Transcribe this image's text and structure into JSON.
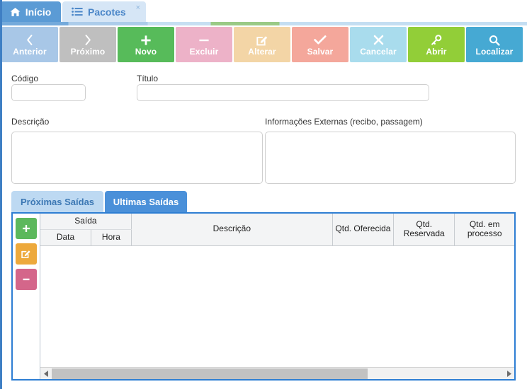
{
  "window": {
    "tabs": [
      {
        "label": "Início",
        "icon": "home-icon",
        "active": true,
        "closable": false
      },
      {
        "label": "Pacotes",
        "icon": "list-icon",
        "active": false,
        "closable": true,
        "close_label": "×"
      }
    ]
  },
  "toolbar": {
    "buttons": [
      {
        "label": "Anterior",
        "icon": "chevron-left-icon",
        "glyph": "❮",
        "color": "#a8c7e7"
      },
      {
        "label": "Próximo",
        "icon": "chevron-right-icon",
        "glyph": "❯",
        "color": "#bfbfbf"
      },
      {
        "label": "Novo",
        "icon": "plus-icon",
        "glyph": "+",
        "color": "#57bb5a"
      },
      {
        "label": "Excluir",
        "icon": "minus-icon",
        "glyph": "—",
        "color": "#edb2c8"
      },
      {
        "label": "Alterar",
        "icon": "pencil-square-icon",
        "glyph": "✎",
        "color": "#f3d5a6"
      },
      {
        "label": "Salvar",
        "icon": "check-icon",
        "glyph": "✔",
        "color": "#f4a79b"
      },
      {
        "label": "Cancelar",
        "icon": "close-x-icon",
        "glyph": "✖",
        "color": "#a9dced"
      },
      {
        "label": "Abrir",
        "icon": "key-icon",
        "glyph": "⚿",
        "color": "#92ce38"
      },
      {
        "label": "Localizar",
        "icon": "search-icon",
        "glyph": "⚲",
        "color": "#46a9d3"
      }
    ]
  },
  "form": {
    "codigo": {
      "label": "Código",
      "value": "",
      "placeholder": ""
    },
    "titulo": {
      "label": "Título",
      "value": "",
      "placeholder": ""
    },
    "descricao": {
      "label": "Descrição",
      "value": "",
      "placeholder": ""
    },
    "info_externas": {
      "label": "Informações Externas (recibo, passagem)",
      "value": "",
      "placeholder": ""
    }
  },
  "grid_section": {
    "tabs": [
      {
        "label": "Próximas Saídas",
        "active": false
      },
      {
        "label": "Ultimas Saídas",
        "active": true
      }
    ],
    "side_actions": [
      {
        "label": "+",
        "icon": "plus-icon",
        "name": "add-row-button",
        "color": "#5cb85c"
      },
      {
        "label": "✎",
        "icon": "pencil-square-icon",
        "name": "edit-row-button",
        "color": "#eda93c"
      },
      {
        "label": "–",
        "icon": "minus-icon",
        "name": "delete-row-button",
        "color": "#d4668a"
      }
    ],
    "columns": {
      "group_saida": "Saída",
      "sub_data": "Data",
      "sub_hora": "Hora",
      "descricao": "Descrição",
      "qtd_oferecida": "Qtd. Oferecida",
      "qtd_reservada": "Qtd. Reservada",
      "qtd_processo": "Qtd. em processo"
    },
    "rows": [],
    "scrollbar": {
      "left_arrow": "◀",
      "right_arrow": "▶",
      "thumb_percent": 70
    }
  },
  "colors": {
    "accent_blue": "#2e7ed3",
    "tab_active": "#5b9bd5",
    "tab_inactive": "#d6e6f6",
    "grid_header_bg": "#f3f4f5"
  }
}
